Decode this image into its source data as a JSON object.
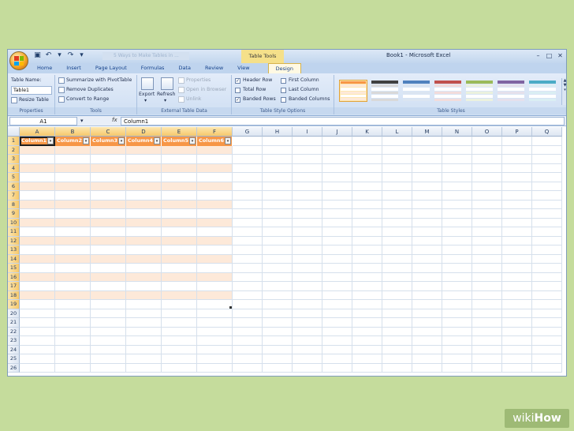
{
  "window": {
    "app_title": "Book1 - Microsoft Excel",
    "doc_title_blurred": "5 Ways to Make Tables in ...",
    "contextual_tab_group": "Table Tools"
  },
  "tabs": [
    {
      "label": "Home"
    },
    {
      "label": "Insert"
    },
    {
      "label": "Page Layout"
    },
    {
      "label": "Formulas"
    },
    {
      "label": "Data"
    },
    {
      "label": "Review"
    },
    {
      "label": "View"
    },
    {
      "label": "Design",
      "active": true
    }
  ],
  "ribbon": {
    "properties": {
      "table_name_label": "Table Name:",
      "table_name_value": "Table1",
      "resize_label": "Resize Table",
      "group_label": "Properties"
    },
    "tools": {
      "summarize": "Summarize with PivotTable",
      "remove_duplicates": "Remove Duplicates",
      "convert_range": "Convert to Range",
      "group_label": "Tools"
    },
    "external": {
      "export": "Export",
      "refresh": "Refresh",
      "properties": "Properties",
      "open_browser": "Open in Browser",
      "unlink": "Unlink",
      "group_label": "External Table Data"
    },
    "style_options": {
      "header_row": {
        "label": "Header Row",
        "checked": true
      },
      "total_row": {
        "label": "Total Row",
        "checked": false
      },
      "banded_rows": {
        "label": "Banded Rows",
        "checked": true
      },
      "first_column": {
        "label": "First Column",
        "checked": false
      },
      "last_column": {
        "label": "Last Column",
        "checked": false
      },
      "banded_columns": {
        "label": "Banded Columns",
        "checked": false
      },
      "group_label": "Table Style Options"
    },
    "table_styles": {
      "group_label": "Table Styles",
      "swatches": [
        {
          "head": "#f79646",
          "band": "#fde9d9"
        },
        {
          "head": "#404040",
          "band": "#d9d9d9"
        },
        {
          "head": "#4f81bd",
          "band": "#dbe5f1"
        },
        {
          "head": "#c0504d",
          "band": "#f2dcdb"
        },
        {
          "head": "#9bbb59",
          "band": "#ebf1de"
        },
        {
          "head": "#8064a2",
          "band": "#e5e0ec"
        },
        {
          "head": "#4bacc6",
          "band": "#daeef3"
        }
      ]
    }
  },
  "formula_bar": {
    "name_box": "A1",
    "fx": "fx",
    "content": "Column1"
  },
  "grid": {
    "columns": [
      "A",
      "B",
      "C",
      "D",
      "E",
      "F",
      "G",
      "H",
      "I",
      "J",
      "K",
      "L",
      "M",
      "N",
      "O",
      "P",
      "Q"
    ],
    "rows": [
      "1",
      "2",
      "3",
      "4",
      "5",
      "6",
      "7",
      "8",
      "9",
      "10",
      "11",
      "12",
      "13",
      "14",
      "15",
      "16",
      "17",
      "18",
      "19",
      "20",
      "21",
      "22",
      "23",
      "24",
      "25",
      "26"
    ],
    "table_headers": [
      "Column1",
      "Column2",
      "Column3",
      "Column4",
      "Column5",
      "Column6"
    ]
  },
  "colors": {
    "table_header": "#f79646",
    "table_band": "#fde9d9",
    "background": "#c5dc9c"
  },
  "watermark": {
    "wiki": "wiki",
    "how": "How"
  }
}
